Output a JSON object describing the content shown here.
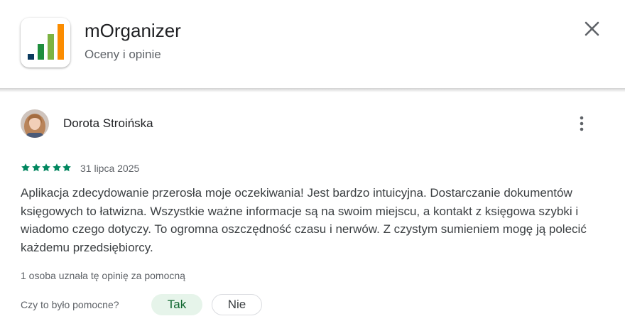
{
  "app": {
    "title": "mOrganizer",
    "subtitle": "Oceny i opinie",
    "icon": "bar-chart-logo",
    "logo_colors": [
      "#0b3a5e",
      "#1e8e3e",
      "#7cb342",
      "#fb8c00"
    ]
  },
  "header": {
    "close_icon": "close-icon"
  },
  "review": {
    "author": "Dorota Stroińska",
    "avatar": "user-photo",
    "more_icon": "more-vert-icon",
    "rating": 5,
    "max_rating": 5,
    "star_color": "#01875f",
    "date": "31 lipca 2025",
    "text": "Aplikacja zdecydowanie przerosła moje oczekiwania! Jest bardzo intuicyjna. Dostarczanie dokumentów księgowych to łatwizna. Wszystkie ważne informacje są na swoim miejscu, a kontakt z księgowa szybki i wiadomo czego dotyczy. To ogromna oszczędność czasu i nerwów. Z czystym sumieniem mogę ją polecić każdemu przedsiębiorcy.",
    "helpful_count_text": "1 osoba uznała tę opinię za pomocną",
    "helpful_question": "Czy to było pomocne?",
    "yes_label": "Tak",
    "no_label": "Nie"
  }
}
